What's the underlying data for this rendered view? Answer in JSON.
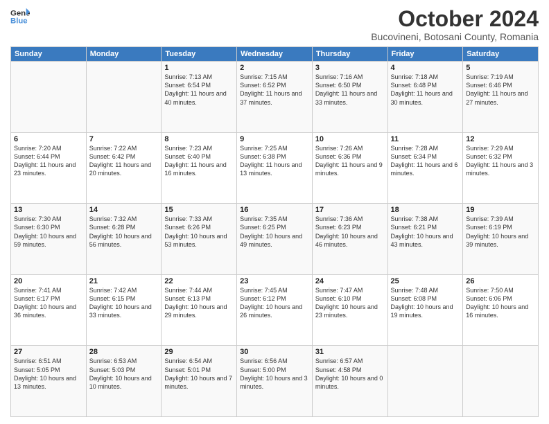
{
  "header": {
    "logo_line1": "General",
    "logo_line2": "Blue",
    "month": "October 2024",
    "location": "Bucovineni, Botosani County, Romania"
  },
  "weekdays": [
    "Sunday",
    "Monday",
    "Tuesday",
    "Wednesday",
    "Thursday",
    "Friday",
    "Saturday"
  ],
  "weeks": [
    [
      {
        "day": "",
        "info": ""
      },
      {
        "day": "",
        "info": ""
      },
      {
        "day": "1",
        "info": "Sunrise: 7:13 AM\nSunset: 6:54 PM\nDaylight: 11 hours\nand 40 minutes."
      },
      {
        "day": "2",
        "info": "Sunrise: 7:15 AM\nSunset: 6:52 PM\nDaylight: 11 hours\nand 37 minutes."
      },
      {
        "day": "3",
        "info": "Sunrise: 7:16 AM\nSunset: 6:50 PM\nDaylight: 11 hours\nand 33 minutes."
      },
      {
        "day": "4",
        "info": "Sunrise: 7:18 AM\nSunset: 6:48 PM\nDaylight: 11 hours\nand 30 minutes."
      },
      {
        "day": "5",
        "info": "Sunrise: 7:19 AM\nSunset: 6:46 PM\nDaylight: 11 hours\nand 27 minutes."
      }
    ],
    [
      {
        "day": "6",
        "info": "Sunrise: 7:20 AM\nSunset: 6:44 PM\nDaylight: 11 hours\nand 23 minutes."
      },
      {
        "day": "7",
        "info": "Sunrise: 7:22 AM\nSunset: 6:42 PM\nDaylight: 11 hours\nand 20 minutes."
      },
      {
        "day": "8",
        "info": "Sunrise: 7:23 AM\nSunset: 6:40 PM\nDaylight: 11 hours\nand 16 minutes."
      },
      {
        "day": "9",
        "info": "Sunrise: 7:25 AM\nSunset: 6:38 PM\nDaylight: 11 hours\nand 13 minutes."
      },
      {
        "day": "10",
        "info": "Sunrise: 7:26 AM\nSunset: 6:36 PM\nDaylight: 11 hours\nand 9 minutes."
      },
      {
        "day": "11",
        "info": "Sunrise: 7:28 AM\nSunset: 6:34 PM\nDaylight: 11 hours\nand 6 minutes."
      },
      {
        "day": "12",
        "info": "Sunrise: 7:29 AM\nSunset: 6:32 PM\nDaylight: 11 hours\nand 3 minutes."
      }
    ],
    [
      {
        "day": "13",
        "info": "Sunrise: 7:30 AM\nSunset: 6:30 PM\nDaylight: 10 hours\nand 59 minutes."
      },
      {
        "day": "14",
        "info": "Sunrise: 7:32 AM\nSunset: 6:28 PM\nDaylight: 10 hours\nand 56 minutes."
      },
      {
        "day": "15",
        "info": "Sunrise: 7:33 AM\nSunset: 6:26 PM\nDaylight: 10 hours\nand 53 minutes."
      },
      {
        "day": "16",
        "info": "Sunrise: 7:35 AM\nSunset: 6:25 PM\nDaylight: 10 hours\nand 49 minutes."
      },
      {
        "day": "17",
        "info": "Sunrise: 7:36 AM\nSunset: 6:23 PM\nDaylight: 10 hours\nand 46 minutes."
      },
      {
        "day": "18",
        "info": "Sunrise: 7:38 AM\nSunset: 6:21 PM\nDaylight: 10 hours\nand 43 minutes."
      },
      {
        "day": "19",
        "info": "Sunrise: 7:39 AM\nSunset: 6:19 PM\nDaylight: 10 hours\nand 39 minutes."
      }
    ],
    [
      {
        "day": "20",
        "info": "Sunrise: 7:41 AM\nSunset: 6:17 PM\nDaylight: 10 hours\nand 36 minutes."
      },
      {
        "day": "21",
        "info": "Sunrise: 7:42 AM\nSunset: 6:15 PM\nDaylight: 10 hours\nand 33 minutes."
      },
      {
        "day": "22",
        "info": "Sunrise: 7:44 AM\nSunset: 6:13 PM\nDaylight: 10 hours\nand 29 minutes."
      },
      {
        "day": "23",
        "info": "Sunrise: 7:45 AM\nSunset: 6:12 PM\nDaylight: 10 hours\nand 26 minutes."
      },
      {
        "day": "24",
        "info": "Sunrise: 7:47 AM\nSunset: 6:10 PM\nDaylight: 10 hours\nand 23 minutes."
      },
      {
        "day": "25",
        "info": "Sunrise: 7:48 AM\nSunset: 6:08 PM\nDaylight: 10 hours\nand 19 minutes."
      },
      {
        "day": "26",
        "info": "Sunrise: 7:50 AM\nSunset: 6:06 PM\nDaylight: 10 hours\nand 16 minutes."
      }
    ],
    [
      {
        "day": "27",
        "info": "Sunrise: 6:51 AM\nSunset: 5:05 PM\nDaylight: 10 hours\nand 13 minutes."
      },
      {
        "day": "28",
        "info": "Sunrise: 6:53 AM\nSunset: 5:03 PM\nDaylight: 10 hours\nand 10 minutes."
      },
      {
        "day": "29",
        "info": "Sunrise: 6:54 AM\nSunset: 5:01 PM\nDaylight: 10 hours\nand 7 minutes."
      },
      {
        "day": "30",
        "info": "Sunrise: 6:56 AM\nSunset: 5:00 PM\nDaylight: 10 hours\nand 3 minutes."
      },
      {
        "day": "31",
        "info": "Sunrise: 6:57 AM\nSunset: 4:58 PM\nDaylight: 10 hours\nand 0 minutes."
      },
      {
        "day": "",
        "info": ""
      },
      {
        "day": "",
        "info": ""
      }
    ]
  ]
}
